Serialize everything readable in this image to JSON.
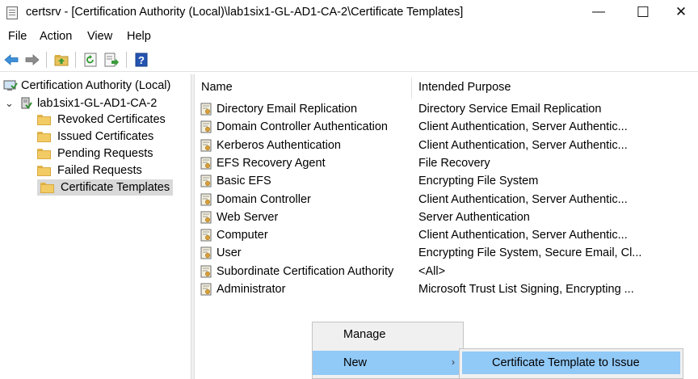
{
  "window": {
    "title": "certsrv - [Certification Authority (Local)\\lab1six1-GL-AD1-CA-2\\Certificate Templates]",
    "minimize": "—",
    "maximize": "☐",
    "close": "✕"
  },
  "menu": [
    "File",
    "Action",
    "View",
    "Help"
  ],
  "toolbar": {
    "icons": [
      "back-arrow-icon",
      "forward-arrow-icon",
      "up-folder-icon",
      "refresh-icon",
      "export-list-icon",
      "help-icon"
    ],
    "help_glyph": "?"
  },
  "tree": {
    "root": "Certification Authority (Local)",
    "ca": "lab1six1-GL-AD1-CA-2",
    "expander": "⌄",
    "folders": [
      "Revoked Certificates",
      "Issued Certificates",
      "Pending Requests",
      "Failed Requests",
      "Certificate Templates"
    ],
    "selected": "Certificate Templates"
  },
  "list": {
    "columns": [
      "Name",
      "Intended Purpose"
    ],
    "rows": [
      {
        "name": "Directory Email Replication",
        "purpose": "Directory Service Email Replication"
      },
      {
        "name": "Domain Controller Authentication",
        "purpose": "Client Authentication, Server Authentic..."
      },
      {
        "name": "Kerberos Authentication",
        "purpose": "Client Authentication, Server Authentic..."
      },
      {
        "name": "EFS Recovery Agent",
        "purpose": "File Recovery"
      },
      {
        "name": "Basic EFS",
        "purpose": "Encrypting File System"
      },
      {
        "name": "Domain Controller",
        "purpose": "Client Authentication, Server Authentic..."
      },
      {
        "name": "Web Server",
        "purpose": "Server Authentication"
      },
      {
        "name": "Computer",
        "purpose": "Client Authentication, Server Authentic..."
      },
      {
        "name": "User",
        "purpose": "Encrypting File System, Secure Email, Cl..."
      },
      {
        "name": "Subordinate Certification Authority",
        "purpose": "<All>"
      },
      {
        "name": "Administrator",
        "purpose": "Microsoft Trust List Signing, Encrypting ..."
      }
    ]
  },
  "context_menu": {
    "items": [
      {
        "label": "Manage",
        "submenu": false
      },
      {
        "label": "New",
        "submenu": true
      }
    ],
    "submenu_arrow": "›",
    "highlighted": "New"
  },
  "submenu": {
    "items": [
      "Certificate Template to Issue"
    ]
  },
  "colors": {
    "highlight": "#91c9f7",
    "selection": "#d9d9d9",
    "folder": "#f2cb64"
  }
}
